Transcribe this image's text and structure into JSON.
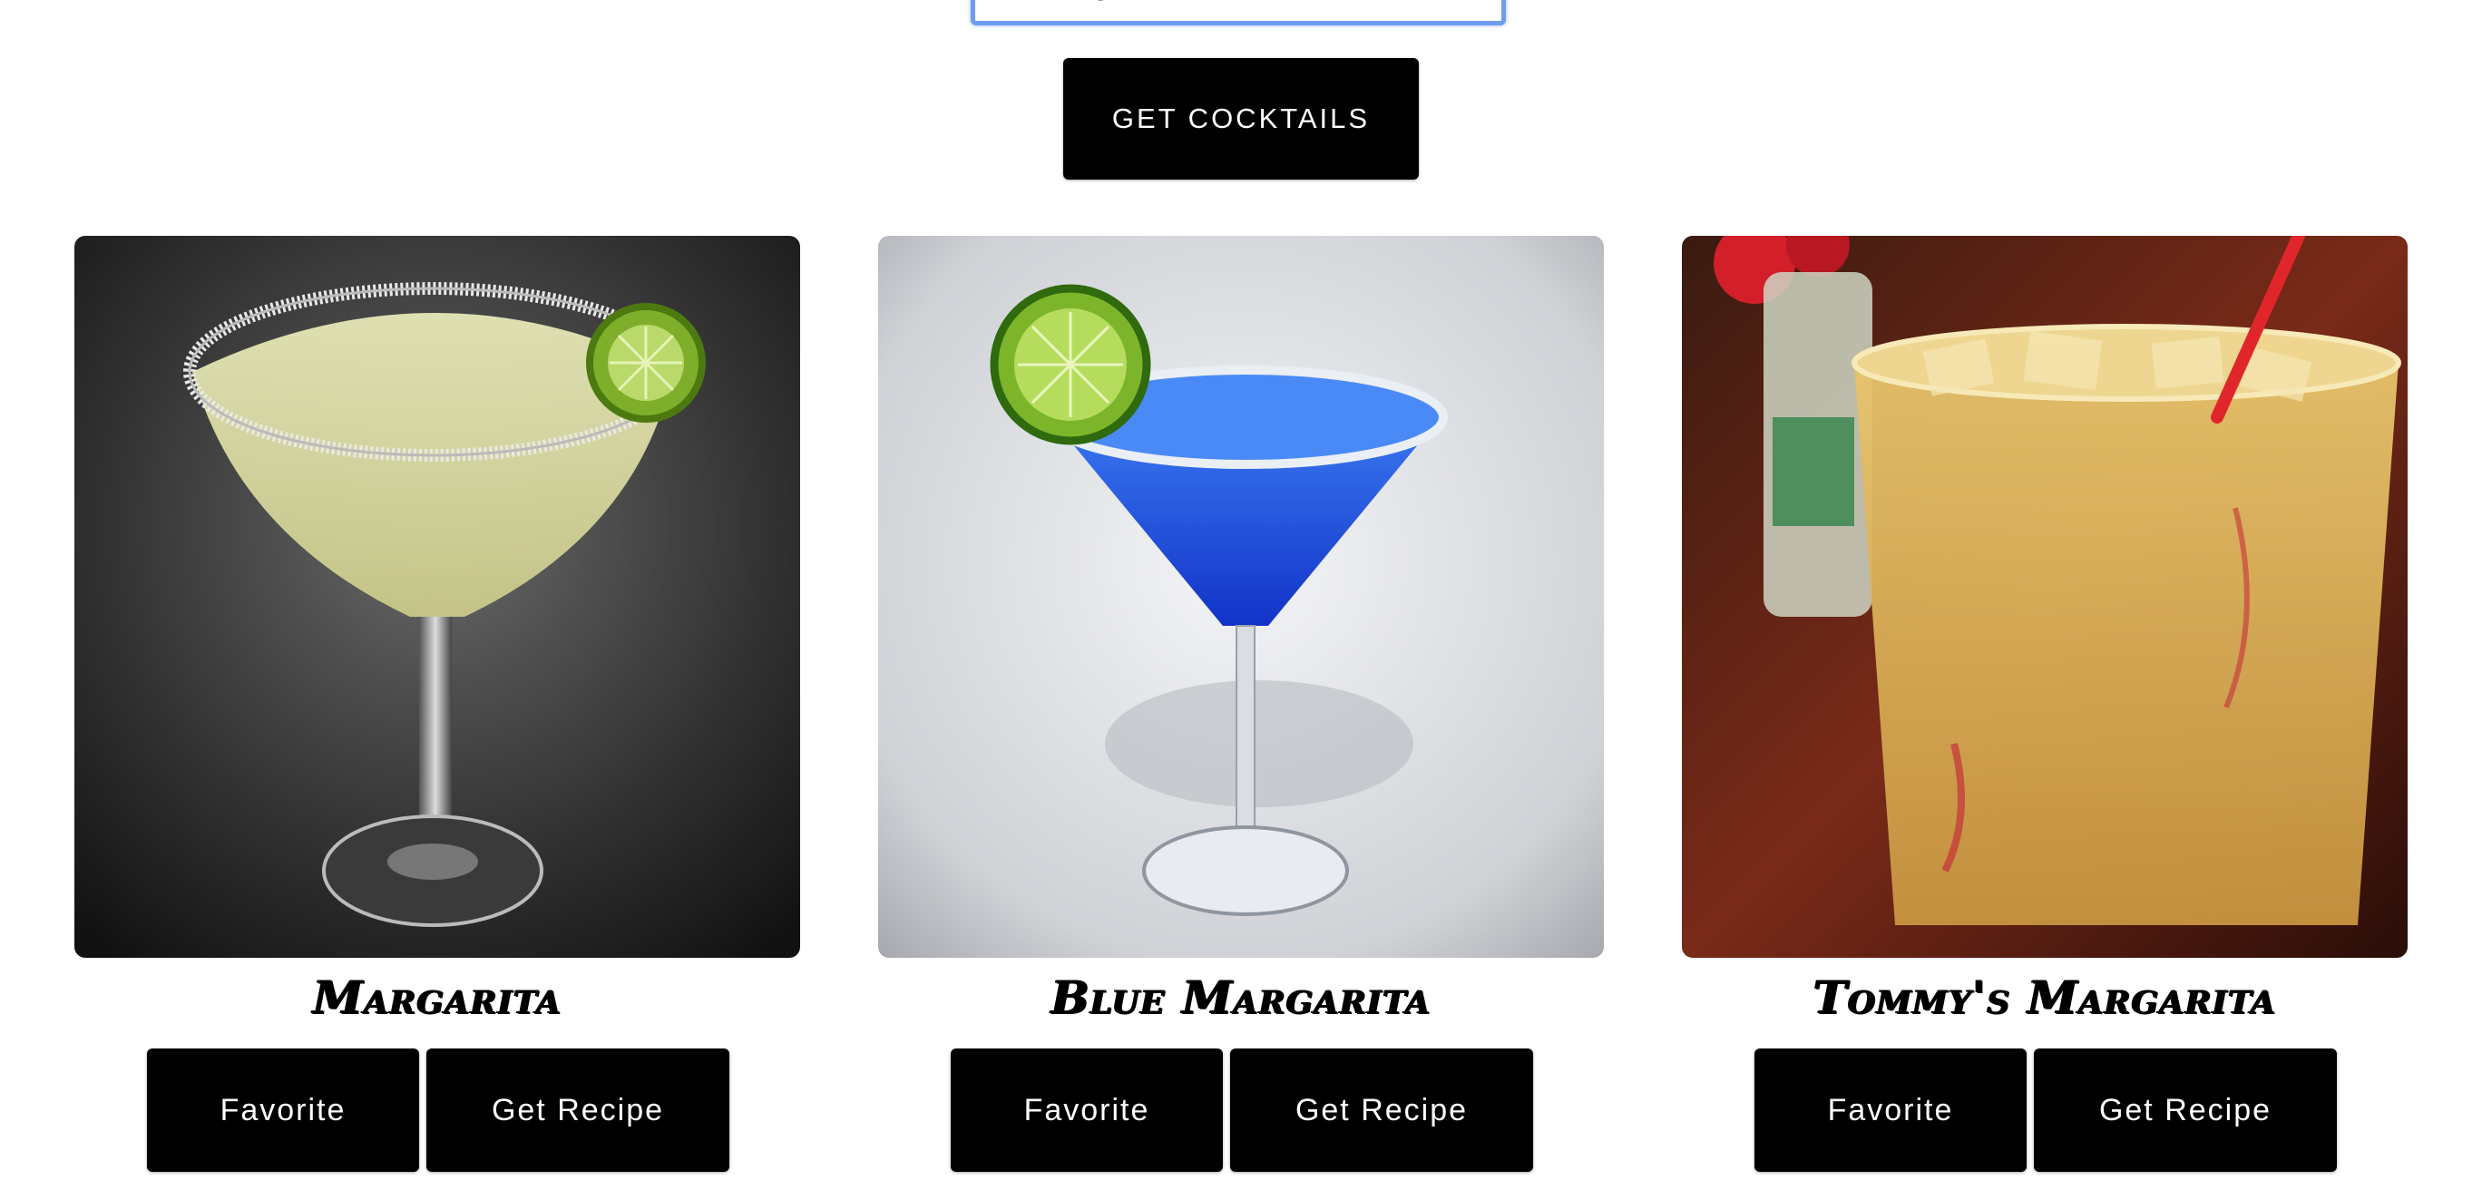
{
  "search": {
    "value": "margarita",
    "placeholder": ""
  },
  "controls": {
    "get_cocktails_label": "Get Cocktails"
  },
  "cards": [
    {
      "title": "Margarita",
      "favorite_label": "Favorite",
      "recipe_label": "Get Recipe",
      "image": "margarita-photo"
    },
    {
      "title": "Blue Margarita",
      "favorite_label": "Favorite",
      "recipe_label": "Get Recipe",
      "image": "blue-margarita-photo"
    },
    {
      "title": "Tommy's Margarita",
      "favorite_label": "Favorite",
      "recipe_label": "Get Recipe",
      "image": "tommys-margarita-photo"
    }
  ],
  "colors": {
    "button_bg": "#000000",
    "button_text": "#ffffff",
    "focus_ring": "#6f9cf0"
  }
}
